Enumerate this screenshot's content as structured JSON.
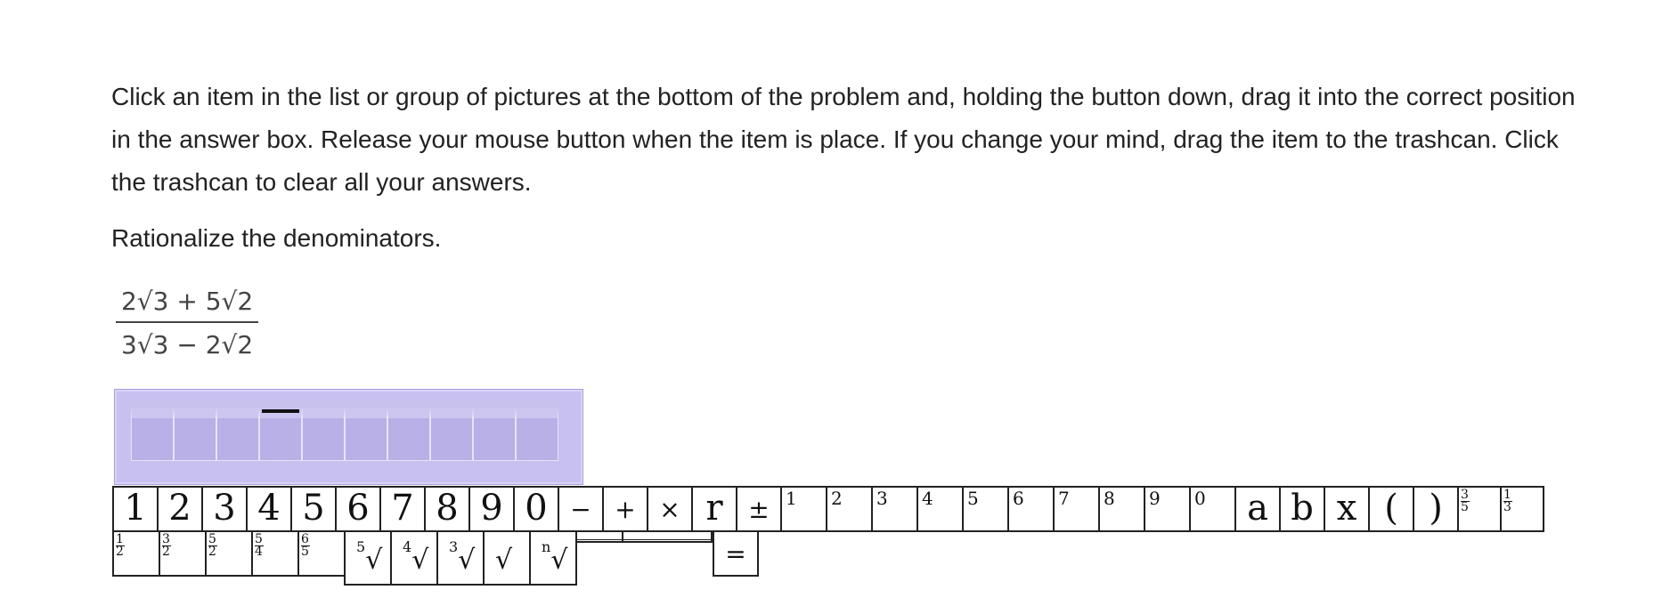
{
  "instructions": "Click an item in the list or group of pictures at the bottom of the problem and, holding the button down, drag it into the correct position in the answer box. Release your mouse button when the item is place. If you change your mind, drag the item to the trashcan. Click the trashcan to clear all your answers.",
  "prompt": "Rationalize the denominators.",
  "expression": {
    "numerator": "2√3 + 5√2",
    "denominator": "3√3 − 2√2"
  },
  "answer_box": {
    "cells": 10
  },
  "palette_row1": [
    {
      "label": "1",
      "kind": "big"
    },
    {
      "label": "2",
      "kind": "big"
    },
    {
      "label": "3",
      "kind": "big"
    },
    {
      "label": "4",
      "kind": "big"
    },
    {
      "label": "5",
      "kind": "big"
    },
    {
      "label": "6",
      "kind": "big"
    },
    {
      "label": "7",
      "kind": "big"
    },
    {
      "label": "8",
      "kind": "big"
    },
    {
      "label": "9",
      "kind": "big"
    },
    {
      "label": "0",
      "kind": "big"
    },
    {
      "label": "−",
      "kind": "op"
    },
    {
      "label": "+",
      "kind": "op"
    },
    {
      "label": "×",
      "kind": "op"
    },
    {
      "label": "r",
      "kind": "big"
    },
    {
      "label": "±",
      "kind": "op"
    },
    {
      "label": "1",
      "kind": "small"
    },
    {
      "label": "2",
      "kind": "small"
    },
    {
      "label": "3",
      "kind": "small"
    },
    {
      "label": "4",
      "kind": "small"
    },
    {
      "label": "5",
      "kind": "small"
    },
    {
      "label": "6",
      "kind": "small"
    },
    {
      "label": "7",
      "kind": "small"
    },
    {
      "label": "8",
      "kind": "small"
    },
    {
      "label": "9",
      "kind": "small"
    },
    {
      "label": "0",
      "kind": "small"
    },
    {
      "label": "a",
      "kind": "big"
    },
    {
      "label": "b",
      "kind": "big"
    },
    {
      "label": "x",
      "kind": "big"
    },
    {
      "label": "(",
      "kind": "big"
    },
    {
      "label": ")",
      "kind": "big"
    },
    {
      "num": "3",
      "den": "5",
      "kind": "frac"
    },
    {
      "num": "1",
      "den": "3",
      "kind": "frac"
    }
  ],
  "palette_row2_fracs": [
    {
      "num": "1",
      "den": "2"
    },
    {
      "num": "3",
      "den": "2"
    },
    {
      "num": "5",
      "den": "2"
    },
    {
      "num": "5",
      "den": "4"
    },
    {
      "num": "6",
      "den": "5"
    }
  ],
  "palette_row2_roots": [
    {
      "index": "5",
      "symbol": "√"
    },
    {
      "index": "4",
      "symbol": "√"
    },
    {
      "index": "3",
      "symbol": "√"
    },
    {
      "index": "",
      "symbol": "√"
    },
    {
      "index": "n",
      "symbol": "√"
    }
  ],
  "palette_row2_equals": "="
}
